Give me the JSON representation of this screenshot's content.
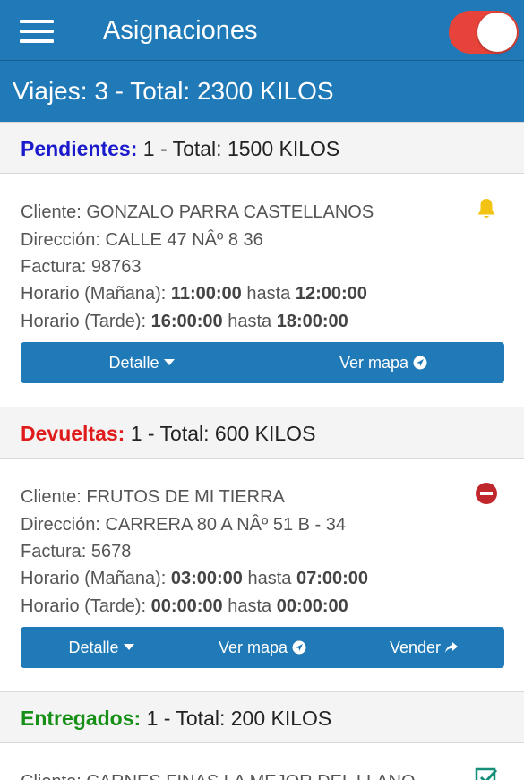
{
  "app": {
    "title": "Asignaciones"
  },
  "summary": {
    "text": "Viajes: 3 - Total: 2300 KILOS"
  },
  "sections": {
    "pendientes": {
      "label": "Pendientes:",
      "rest": " 1 - Total: 1500 KILOS",
      "color": "#1a1acc",
      "card": {
        "cliente": "Cliente: GONZALO PARRA CASTELLANOS",
        "direccion": "Dirección: CALLE 47 NÂº 8 36",
        "factura": "Factura: 98763",
        "manana_label": "Horario (Mañana): ",
        "manana_from": "11:00:00",
        "manana_to": "12:00:00",
        "tarde_label": "Horario (Tarde): ",
        "tarde_from": "16:00:00",
        "tarde_to": "18:00:00",
        "hasta": " hasta ",
        "detalle": "Detalle",
        "ver_mapa": "Ver mapa",
        "status_icon": "bell-icon"
      }
    },
    "devueltas": {
      "label": "Devueltas:",
      "rest": " 1 - Total: 600 KILOS",
      "color": "#e01b1b",
      "card": {
        "cliente": "Cliente: FRUTOS DE MI TIERRA",
        "direccion": "Dirección: CARRERA 80 A NÂº 51 B - 34",
        "factura": "Factura: 5678",
        "manana_label": "Horario (Mañana): ",
        "manana_from": "03:00:00",
        "manana_to": "07:00:00",
        "tarde_label": "Horario (Tarde): ",
        "tarde_from": "00:00:00",
        "tarde_to": "00:00:00",
        "hasta": " hasta ",
        "detalle": "Detalle",
        "ver_mapa": "Ver mapa",
        "vender": "Vender",
        "status_icon": "minus-circle-icon"
      }
    },
    "entregados": {
      "label": "Entregados:",
      "rest": " 1 - Total: 200 KILOS",
      "color": "#168f16",
      "card": {
        "cliente": "Cliente: CARNES FINAS LA MEJOR DEL LLANO",
        "status_icon": "checkbox-checked-icon"
      }
    }
  }
}
